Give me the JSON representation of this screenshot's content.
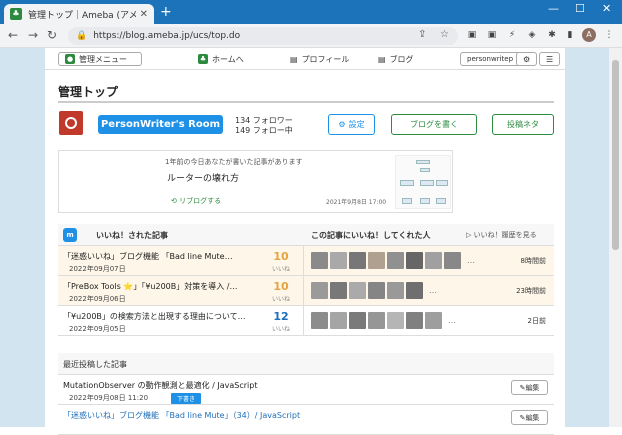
{
  "browser": {
    "tab_title": "管理トップ｜Ameba (アメーバ)",
    "url": "https://blog.ameba.jp/ucs/top.do",
    "avatar_letter": "A"
  },
  "nav": {
    "admin_menu": "管理メニュー",
    "home": "ホームへ",
    "profile": "プロフィール",
    "blog": "ブログ",
    "user_id": "personwritep"
  },
  "header": {
    "page_title": "管理トップ"
  },
  "profile": {
    "room_name": "PersonWriter's Room",
    "followers": "134 フォロワー",
    "following": "149 フォロー中",
    "settings_label": "設定",
    "write_label": "ブログを書く",
    "neta_label": "投稿ネタ"
  },
  "memory": {
    "intro": "1年前の今日あなたが書いた記事があります",
    "title": "ルーターの壊れ方",
    "reblog": "リブログする",
    "datetime": "2021年9月8日 17:00"
  },
  "likes": {
    "title": "いいね！された記事",
    "right_title": "この記事にいいね！してくれた人",
    "history_link": "いいね！履歴を見る",
    "count_label": "いいね",
    "rows": [
      {
        "title": "「迷惑いいね」ブログ機能 「Bad line Mute…",
        "date": "2022年09月07日",
        "count": "10",
        "ago": "8時間前"
      },
      {
        "title": "「PreBox Tools ⭐」「¥u200B」対策を導入 /…",
        "date": "2022年09月06日",
        "count": "10",
        "ago": "23時間前"
      },
      {
        "title": "「¥u200B」の検索方法と出現する理由について…",
        "date": "2022年09月05日",
        "count": "12",
        "ago": "2日前"
      }
    ]
  },
  "recent": {
    "title": "最近投稿した記事",
    "edit_label": "編集",
    "rows": [
      {
        "title": "MutationObserver の動作観測と最適化 / JavaScript",
        "date": "2022年09月08日 11:20",
        "status": "下書き"
      },
      {
        "title": "「迷惑いいね」ブログ機能 「Bad line Mute」（34）/ JavaScript",
        "date": "",
        "status": ""
      }
    ]
  }
}
